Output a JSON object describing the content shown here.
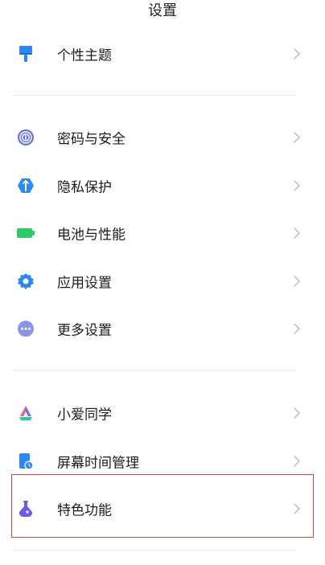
{
  "header": {
    "title": "设置"
  },
  "colors": {
    "highlight": "#d64545",
    "chevron": "#bdbdbd",
    "divider": "#ececec"
  },
  "groups": [
    {
      "items": [
        {
          "label": "个性主题",
          "icon": "paint-roller-icon",
          "color": "#2f86f0"
        }
      ]
    },
    {
      "items": [
        {
          "label": "密码与安全",
          "icon": "fingerprint-icon",
          "color": "#6a74d8"
        },
        {
          "label": "隐私保护",
          "icon": "privacy-shield-icon",
          "color": "#2a8cf0"
        },
        {
          "label": "电池与性能",
          "icon": "battery-icon",
          "color": "#2fc96a"
        },
        {
          "label": "应用设置",
          "icon": "gear-icon",
          "color": "#2b86ee"
        },
        {
          "label": "更多设置",
          "icon": "more-dots-icon",
          "color": "#8a94e4"
        }
      ]
    },
    {
      "items": [
        {
          "label": "小爱同学",
          "icon": "xiaoai-icon",
          "color": "#f05d7e"
        },
        {
          "label": "屏幕时间管理",
          "icon": "screen-time-icon",
          "color": "#2f86f0"
        },
        {
          "label": "特色功能",
          "icon": "flask-icon",
          "color": "#6e5ce4",
          "highlighted": true
        }
      ]
    }
  ]
}
